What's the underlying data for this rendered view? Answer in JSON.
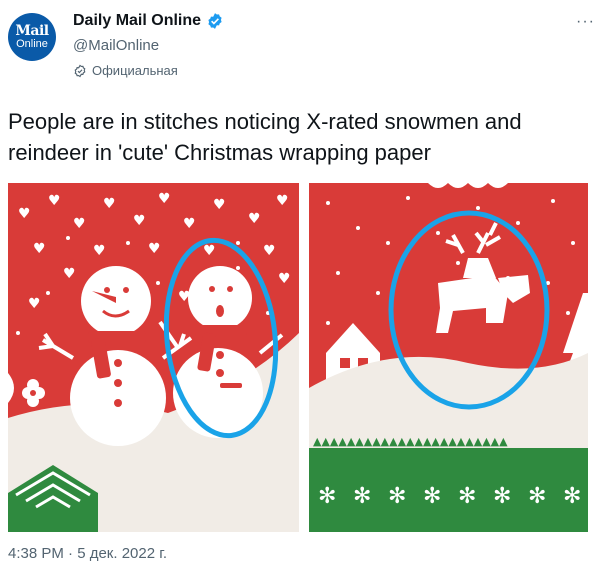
{
  "account": {
    "avatar_line1": "Mail",
    "avatar_line2": "Online",
    "display_name": "Daily Mail Online",
    "handle": "@MailOnline",
    "official_label": "Официальная"
  },
  "tweet": {
    "text": "People are in stitches noticing X-rated snowmen and reindeer in 'cute' Christmas wrapping paper",
    "timestamp": "4:38 PM · 5 дек. 2022 г."
  },
  "icons": {
    "verified": "verified-badge-icon",
    "official": "official-check-icon",
    "more": "more-options-icon"
  },
  "colors": {
    "accent": "#1d9bf0",
    "brand": "#0a5aa8",
    "paper_red": "#d93b38",
    "paper_green": "#2f8a3f",
    "highlight": "#1aa3e8"
  }
}
